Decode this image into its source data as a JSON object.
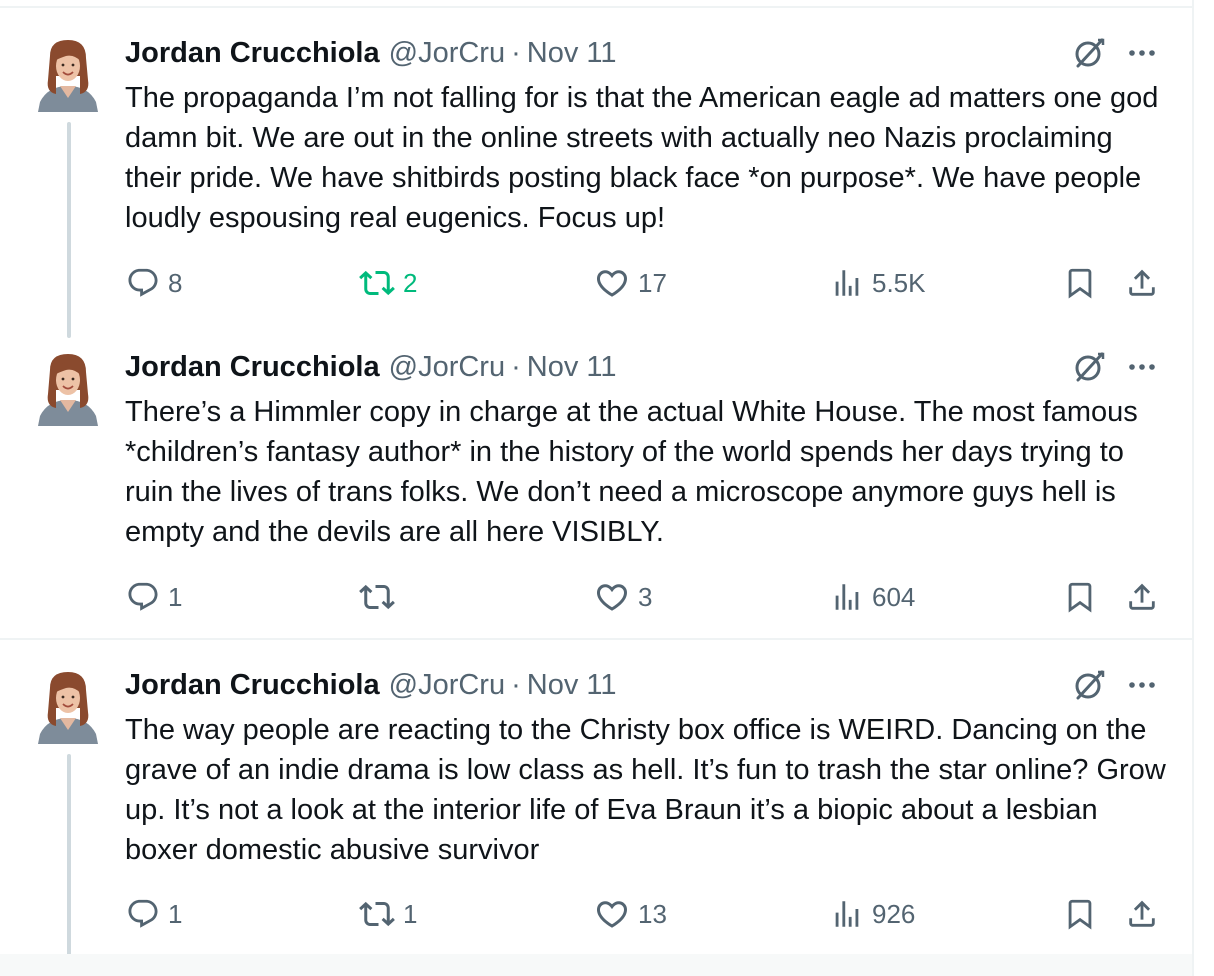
{
  "colors": {
    "text": "#0f1419",
    "secondary": "#536471",
    "retweet_active": "#00ba7c",
    "border": "#eff3f4",
    "thread_line": "#cfd9de"
  },
  "icons": {
    "reply": "reply-icon",
    "retweet": "retweet-icon",
    "like": "heart-icon",
    "views": "views-icon",
    "bookmark": "bookmark-icon",
    "share": "share-icon",
    "grok": "grok-icon",
    "more": "more-icon"
  },
  "tweets": [
    {
      "name": "Jordan Crucchiola",
      "handle": "@JorCru",
      "separator": "·",
      "date": "Nov 11",
      "text": "The propaganda I’m not falling for is that the American eagle ad matters one god damn bit. We are out in the online streets with actually neo Nazis proclaiming their pride. We have shitbirds posting black face *on purpose*. We have people loudly espousing real eugenics. Focus up!",
      "replies": "8",
      "retweets": "2",
      "retweeted": true,
      "likes": "17",
      "views": "5.5K"
    },
    {
      "name": "Jordan Crucchiola",
      "handle": "@JorCru",
      "separator": "·",
      "date": "Nov 11",
      "text": "There’s a Himmler copy in charge at the actual White House. The most famous *children’s fantasy author* in the history of the world spends her days trying to ruin the lives of trans folks. We don’t need a microscope anymore guys hell is empty and the devils are all here VISIBLY.",
      "replies": "1",
      "retweets": "",
      "retweeted": false,
      "likes": "3",
      "views": "604"
    },
    {
      "name": "Jordan Crucchiola",
      "handle": "@JorCru",
      "separator": "·",
      "date": "Nov 11",
      "text": "The way people are reacting to the Christy box office is WEIRD. Dancing on the grave of an indie drama is low class as hell. It’s fun to trash the star online? Grow up. It’s not a look at the interior life of Eva Braun it’s a biopic about a lesbian boxer domestic abusive survivor",
      "replies": "1",
      "retweets": "1",
      "retweeted": false,
      "likes": "13",
      "views": "926"
    }
  ]
}
